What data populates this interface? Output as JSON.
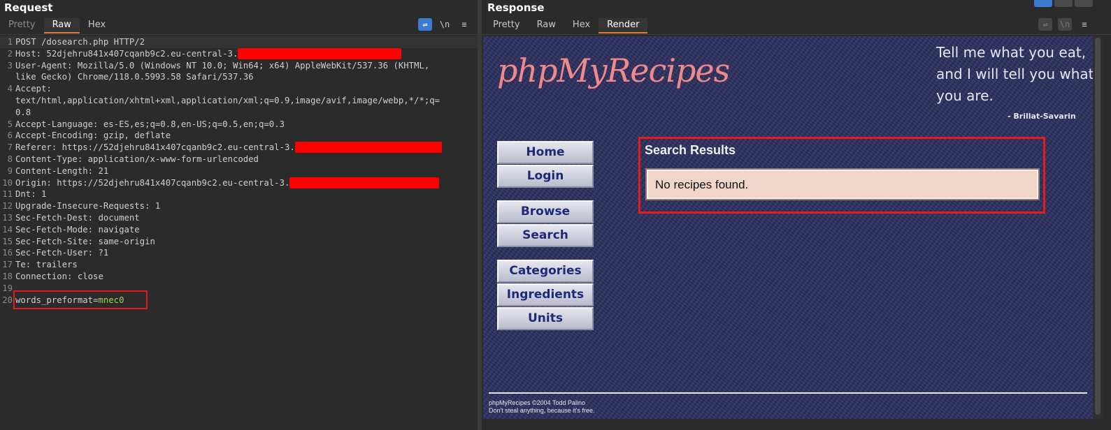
{
  "request": {
    "title": "Request",
    "tabs": [
      "Pretty",
      "Raw",
      "Hex"
    ],
    "active_tab": "Raw",
    "tool_wrap": "⇌",
    "tool_newline": "\\n",
    "tool_menu": "≡",
    "lines": [
      {
        "n": "1",
        "text": "POST /dosearch.php HTTP/2"
      },
      {
        "n": "2",
        "text": "Host: 52djehru841x407cqanb9c2.eu-central-3."
      },
      {
        "n": "3",
        "text": "User-Agent: Mozilla/5.0 (Windows NT 10.0; Win64; x64) AppleWebKit/537.36 (KHTML,"
      },
      {
        "n": "",
        "text": "like Gecko) Chrome/118.0.5993.58 Safari/537.36"
      },
      {
        "n": "4",
        "text": "Accept:"
      },
      {
        "n": "",
        "text": "text/html,application/xhtml+xml,application/xml;q=0.9,image/avif,image/webp,*/*;q="
      },
      {
        "n": "",
        "text": "0.8"
      },
      {
        "n": "5",
        "text": "Accept-Language: es-ES,es;q=0.8,en-US;q=0.5,en;q=0.3"
      },
      {
        "n": "6",
        "text": "Accept-Encoding: gzip, deflate"
      },
      {
        "n": "7",
        "text": "Referer: https://52djehru841x407cqanb9c2.eu-central-3."
      },
      {
        "n": "8",
        "text": "Content-Type: application/x-www-form-urlencoded"
      },
      {
        "n": "9",
        "text": "Content-Length: 21"
      },
      {
        "n": "10",
        "text": "Origin: https://52djehru841x407cqanb9c2.eu-central-3."
      },
      {
        "n": "11",
        "text": "Dnt: 1"
      },
      {
        "n": "12",
        "text": "Upgrade-Insecure-Requests: 1"
      },
      {
        "n": "13",
        "text": "Sec-Fetch-Dest: document"
      },
      {
        "n": "14",
        "text": "Sec-Fetch-Mode: navigate"
      },
      {
        "n": "15",
        "text": "Sec-Fetch-Site: same-origin"
      },
      {
        "n": "16",
        "text": "Sec-Fetch-User: ?1"
      },
      {
        "n": "17",
        "text": "Te: trailers"
      },
      {
        "n": "18",
        "text": "Connection: close"
      },
      {
        "n": "19",
        "text": ""
      },
      {
        "n": "20",
        "text": "words_preformat="
      }
    ],
    "body_param_value": "mnec0"
  },
  "response": {
    "title": "Response",
    "tabs": [
      "Pretty",
      "Raw",
      "Hex",
      "Render"
    ],
    "active_tab": "Render",
    "page": {
      "logo": "phpMyRecipes",
      "quote": "Tell me what you eat, and I will tell you what you are.",
      "quote_author": "- Brillat-Savarin",
      "nav": [
        "Home",
        "Login",
        "Browse",
        "Search",
        "Categories",
        "Ingredients",
        "Units"
      ],
      "results_title": "Search Results",
      "results_message": "No recipes found.",
      "footer_line1": "phpMyRecipes ©2004 Todd Palino",
      "footer_line2": "Don't steal anything, because it's free."
    }
  },
  "colors": {
    "accent_tab": "#e07b39",
    "highlight_box": "#e81b1b",
    "redaction": "#ff0000",
    "render_bg": "#2c2f5e",
    "logo": "#f08a8a"
  }
}
